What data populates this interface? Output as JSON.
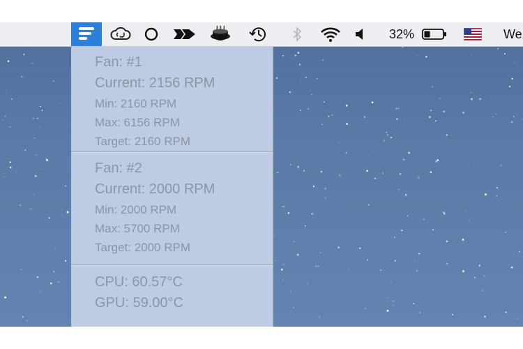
{
  "menubar": {
    "battery_percent": "32%",
    "battery_level": 0.32,
    "clock_partial": "We",
    "icons": [
      "fan-monitor-icon",
      "creative-cloud-icon",
      "circle-icon",
      "arrow-icon",
      "coffee-cup-icon",
      "time-machine-icon",
      "bluetooth-icon",
      "wifi-icon",
      "volume-icon",
      "battery-icon",
      "us-flag-icon"
    ],
    "accent_color": "#2d7fdc"
  },
  "dropdown": {
    "fans": [
      {
        "title": "Fan: #1",
        "current": "Current: 2156 RPM",
        "min": "Min: 2160 RPM",
        "max": "Max: 6156 RPM",
        "target": "Target: 2160 RPM"
      },
      {
        "title": "Fan: #2",
        "current": "Current: 2000 RPM",
        "min": "Min: 2000 RPM",
        "max": "Max: 5700 RPM",
        "target": "Target: 2000 RPM"
      }
    ],
    "temps": {
      "cpu": "CPU: 60.57°C",
      "gpu": "GPU: 59.00°C"
    }
  }
}
